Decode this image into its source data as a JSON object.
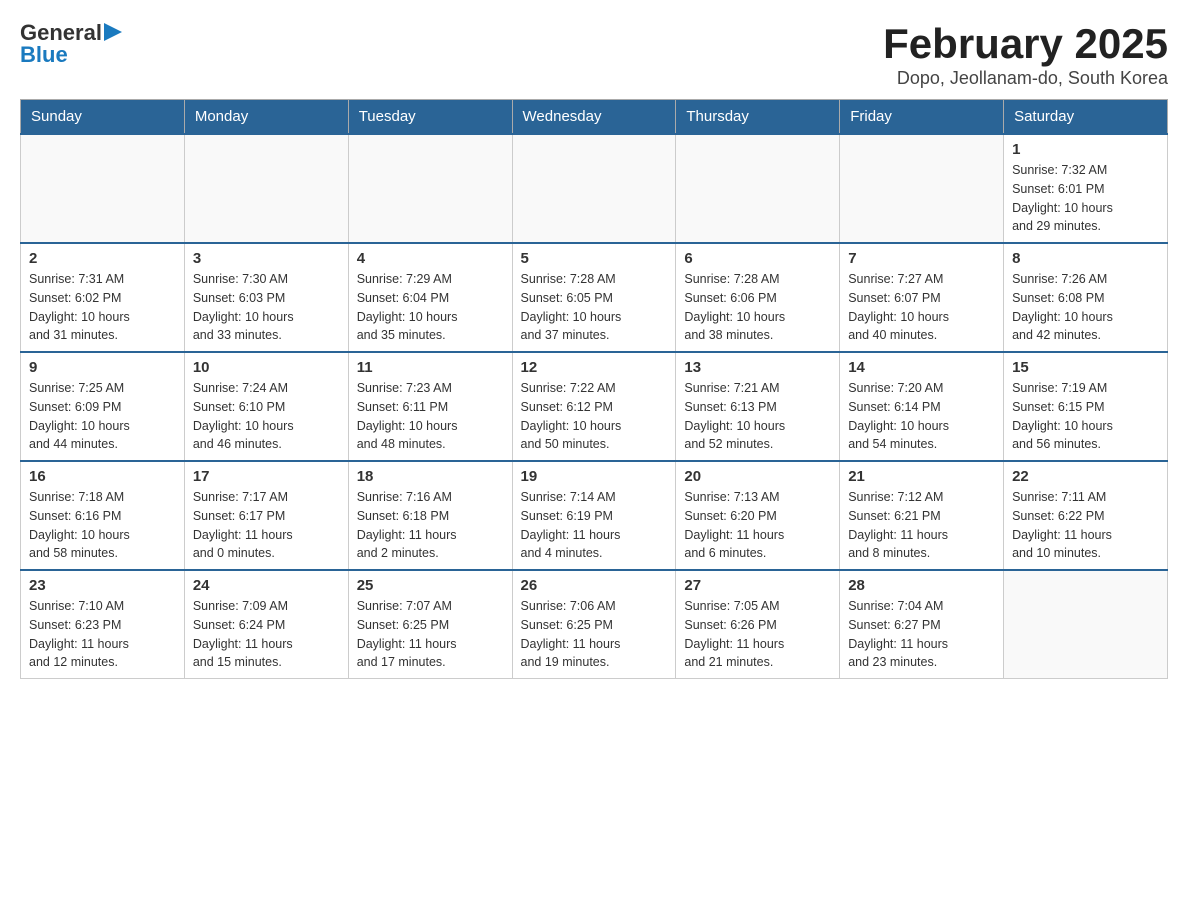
{
  "header": {
    "logo_general": "General",
    "logo_blue": "Blue",
    "title": "February 2025",
    "subtitle": "Dopo, Jeollanam-do, South Korea"
  },
  "days_of_week": [
    "Sunday",
    "Monday",
    "Tuesday",
    "Wednesday",
    "Thursday",
    "Friday",
    "Saturday"
  ],
  "weeks": [
    [
      {
        "day": "",
        "info": ""
      },
      {
        "day": "",
        "info": ""
      },
      {
        "day": "",
        "info": ""
      },
      {
        "day": "",
        "info": ""
      },
      {
        "day": "",
        "info": ""
      },
      {
        "day": "",
        "info": ""
      },
      {
        "day": "1",
        "info": "Sunrise: 7:32 AM\nSunset: 6:01 PM\nDaylight: 10 hours\nand 29 minutes."
      }
    ],
    [
      {
        "day": "2",
        "info": "Sunrise: 7:31 AM\nSunset: 6:02 PM\nDaylight: 10 hours\nand 31 minutes."
      },
      {
        "day": "3",
        "info": "Sunrise: 7:30 AM\nSunset: 6:03 PM\nDaylight: 10 hours\nand 33 minutes."
      },
      {
        "day": "4",
        "info": "Sunrise: 7:29 AM\nSunset: 6:04 PM\nDaylight: 10 hours\nand 35 minutes."
      },
      {
        "day": "5",
        "info": "Sunrise: 7:28 AM\nSunset: 6:05 PM\nDaylight: 10 hours\nand 37 minutes."
      },
      {
        "day": "6",
        "info": "Sunrise: 7:28 AM\nSunset: 6:06 PM\nDaylight: 10 hours\nand 38 minutes."
      },
      {
        "day": "7",
        "info": "Sunrise: 7:27 AM\nSunset: 6:07 PM\nDaylight: 10 hours\nand 40 minutes."
      },
      {
        "day": "8",
        "info": "Sunrise: 7:26 AM\nSunset: 6:08 PM\nDaylight: 10 hours\nand 42 minutes."
      }
    ],
    [
      {
        "day": "9",
        "info": "Sunrise: 7:25 AM\nSunset: 6:09 PM\nDaylight: 10 hours\nand 44 minutes."
      },
      {
        "day": "10",
        "info": "Sunrise: 7:24 AM\nSunset: 6:10 PM\nDaylight: 10 hours\nand 46 minutes."
      },
      {
        "day": "11",
        "info": "Sunrise: 7:23 AM\nSunset: 6:11 PM\nDaylight: 10 hours\nand 48 minutes."
      },
      {
        "day": "12",
        "info": "Sunrise: 7:22 AM\nSunset: 6:12 PM\nDaylight: 10 hours\nand 50 minutes."
      },
      {
        "day": "13",
        "info": "Sunrise: 7:21 AM\nSunset: 6:13 PM\nDaylight: 10 hours\nand 52 minutes."
      },
      {
        "day": "14",
        "info": "Sunrise: 7:20 AM\nSunset: 6:14 PM\nDaylight: 10 hours\nand 54 minutes."
      },
      {
        "day": "15",
        "info": "Sunrise: 7:19 AM\nSunset: 6:15 PM\nDaylight: 10 hours\nand 56 minutes."
      }
    ],
    [
      {
        "day": "16",
        "info": "Sunrise: 7:18 AM\nSunset: 6:16 PM\nDaylight: 10 hours\nand 58 minutes."
      },
      {
        "day": "17",
        "info": "Sunrise: 7:17 AM\nSunset: 6:17 PM\nDaylight: 11 hours\nand 0 minutes."
      },
      {
        "day": "18",
        "info": "Sunrise: 7:16 AM\nSunset: 6:18 PM\nDaylight: 11 hours\nand 2 minutes."
      },
      {
        "day": "19",
        "info": "Sunrise: 7:14 AM\nSunset: 6:19 PM\nDaylight: 11 hours\nand 4 minutes."
      },
      {
        "day": "20",
        "info": "Sunrise: 7:13 AM\nSunset: 6:20 PM\nDaylight: 11 hours\nand 6 minutes."
      },
      {
        "day": "21",
        "info": "Sunrise: 7:12 AM\nSunset: 6:21 PM\nDaylight: 11 hours\nand 8 minutes."
      },
      {
        "day": "22",
        "info": "Sunrise: 7:11 AM\nSunset: 6:22 PM\nDaylight: 11 hours\nand 10 minutes."
      }
    ],
    [
      {
        "day": "23",
        "info": "Sunrise: 7:10 AM\nSunset: 6:23 PM\nDaylight: 11 hours\nand 12 minutes."
      },
      {
        "day": "24",
        "info": "Sunrise: 7:09 AM\nSunset: 6:24 PM\nDaylight: 11 hours\nand 15 minutes."
      },
      {
        "day": "25",
        "info": "Sunrise: 7:07 AM\nSunset: 6:25 PM\nDaylight: 11 hours\nand 17 minutes."
      },
      {
        "day": "26",
        "info": "Sunrise: 7:06 AM\nSunset: 6:25 PM\nDaylight: 11 hours\nand 19 minutes."
      },
      {
        "day": "27",
        "info": "Sunrise: 7:05 AM\nSunset: 6:26 PM\nDaylight: 11 hours\nand 21 minutes."
      },
      {
        "day": "28",
        "info": "Sunrise: 7:04 AM\nSunset: 6:27 PM\nDaylight: 11 hours\nand 23 minutes."
      },
      {
        "day": "",
        "info": ""
      }
    ]
  ]
}
